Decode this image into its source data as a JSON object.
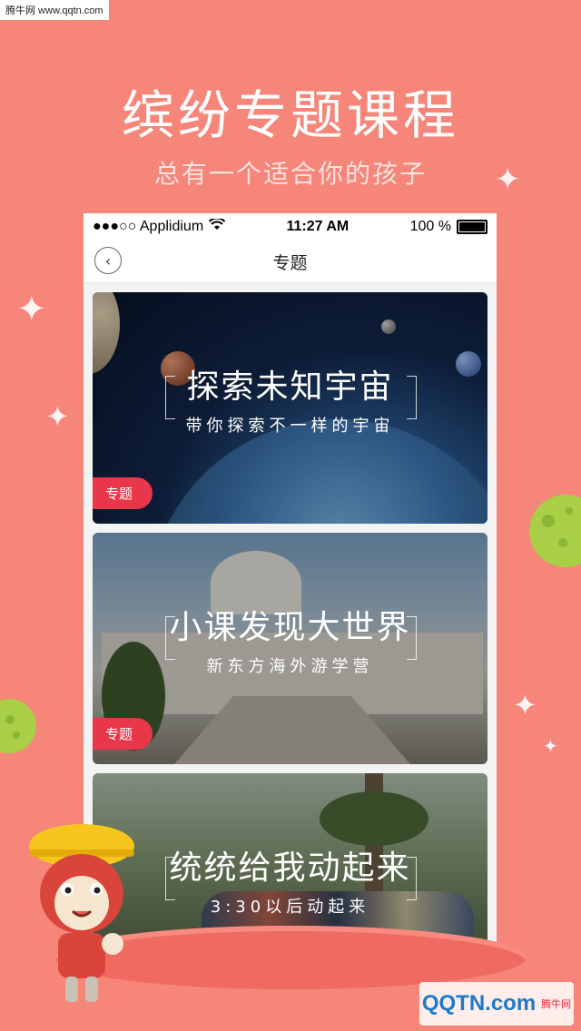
{
  "watermark": {
    "text": "腾牛网 www.qqtn.com"
  },
  "promo": {
    "headline": "缤纷专题课程",
    "subheadline": "总有一个适合你的孩子"
  },
  "status_bar": {
    "carrier": "●●●○○ Applidium",
    "time": "11:27 AM",
    "battery": "100 %"
  },
  "nav": {
    "title": "专题",
    "back_icon": "chevron-left-icon"
  },
  "cards": [
    {
      "title": "探索未知宇宙",
      "subtitle": "带你探索不一样的宇宙",
      "tag": "专题"
    },
    {
      "title": "小课发现大世界",
      "subtitle": "新东方海外游学营",
      "tag": "专题"
    },
    {
      "title": "统统给我动起来",
      "subtitle": "3:30以后动起来"
    }
  ],
  "logo": {
    "text": "QQTN.com",
    "badge": "腾牛网"
  },
  "colors": {
    "background": "#f6857a",
    "tag": "#e8374a",
    "accent_green": "#a8cf45"
  }
}
